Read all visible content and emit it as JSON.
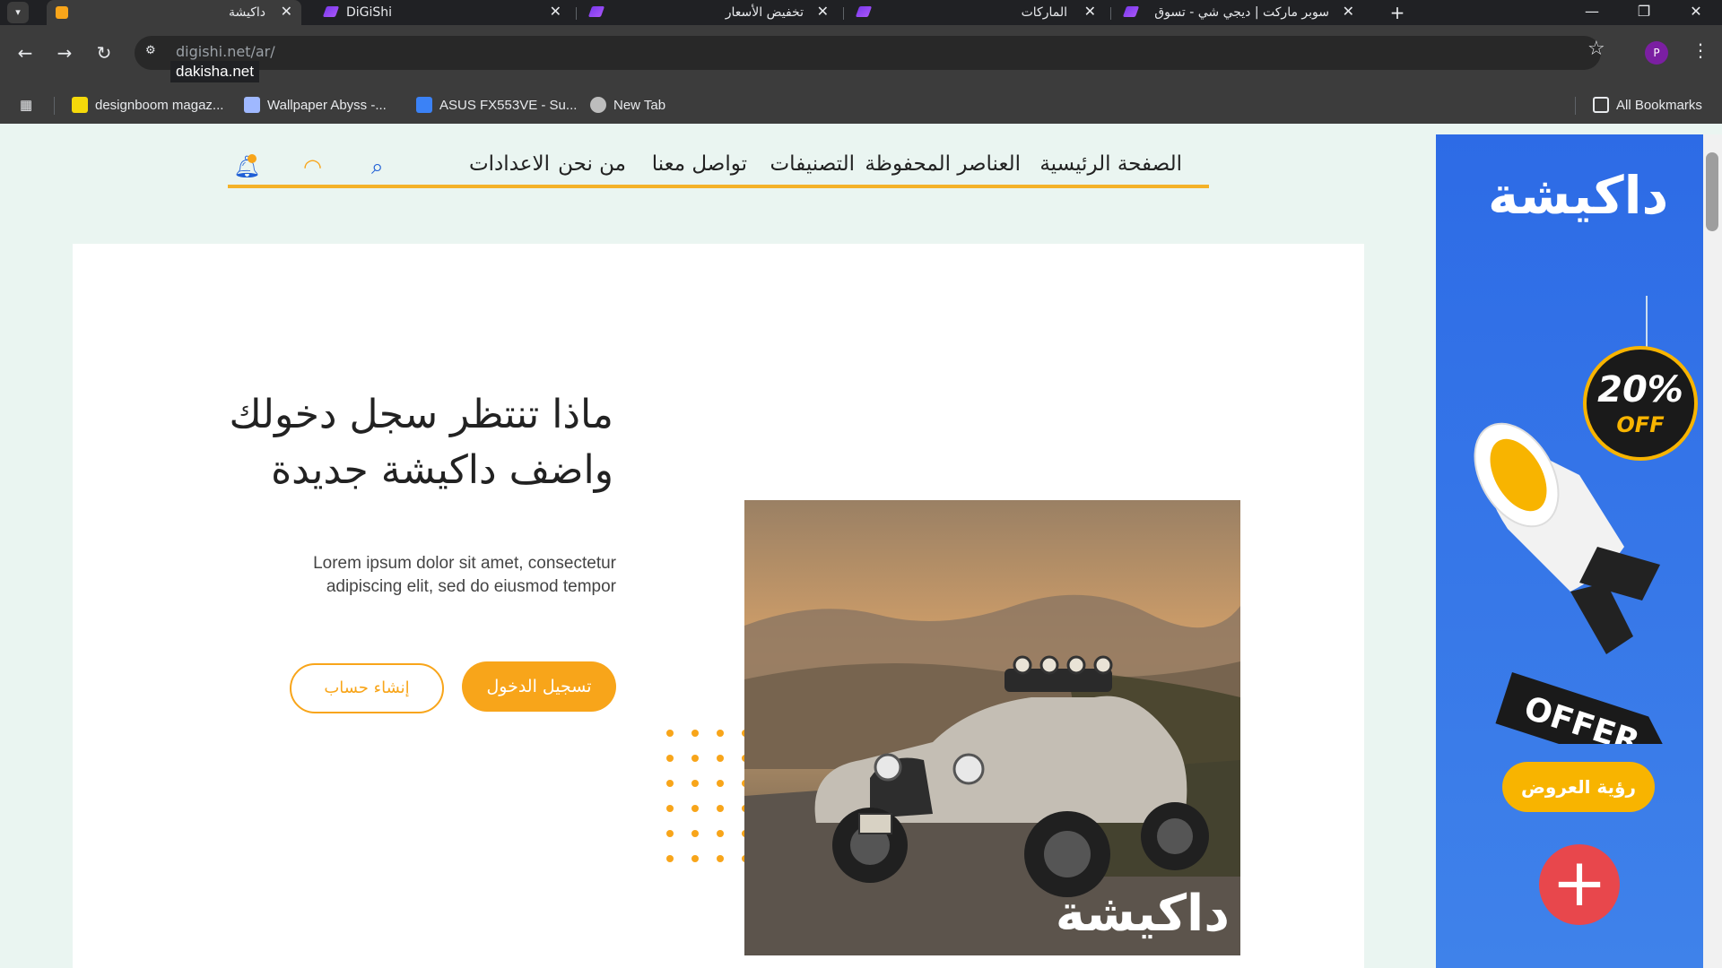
{
  "browser": {
    "tab_menu_icon": "chevron-down-icon",
    "tabs": [
      {
        "title": "داكيشة",
        "close": "✕",
        "active": true
      },
      {
        "title": "DiGiShi",
        "close": "✕",
        "active": false
      },
      {
        "title": "تخفيض الأسعار",
        "close": "✕",
        "active": false
      },
      {
        "title": "الماركات",
        "close": "✕",
        "active": false
      },
      {
        "title": "سوبر ماركت | ديجي شي - تسوق",
        "close": "✕",
        "active": false
      }
    ],
    "new_tab": "+",
    "window_controls": {
      "minimize": "—",
      "restore": "❐",
      "close": "✕"
    },
    "url": "digishi.net/ar/",
    "url_tooltip": "dakisha.net",
    "profile_initial": "P",
    "bookmarks": [
      {
        "label": "designboom magaz...",
        "icon_color": "#f5d90a"
      },
      {
        "label": "Wallpaper Abyss -...",
        "icon_color": "#9fb8ff"
      },
      {
        "label": "ASUS FX553VE - Su...",
        "icon_color": "#3b82f6"
      },
      {
        "label": "New Tab",
        "icon_color": "#bdbdbd"
      }
    ],
    "all_bookmarks": "All Bookmarks"
  },
  "site": {
    "nav": {
      "items": [
        "الصفحة الرئيسية",
        "العناصر المحفوظة",
        "التصنيفات",
        "تواصل معنا",
        "من نحن",
        "الاعدادات"
      ],
      "search_icon": "search-icon",
      "user_icon": "user-icon",
      "bell_icon": "bell-icon"
    },
    "hero": {
      "title_line1": "ماذا تنتظر سجل دخولك",
      "title_line2": "واضف داكيشة جديدة",
      "text_line1": "Lorem ipsum dolor sit amet, consectetur",
      "text_line2": "adipiscing elit, sed do eiusmod tempor",
      "login_label": "تسجيل الدخول",
      "register_label": "إنشاء حساب",
      "watermark": "داكيشة"
    },
    "ad": {
      "logo": "داكيشة",
      "badge_top": "20%",
      "badge_bottom": "OFF",
      "tag": "OFFER",
      "button": "رؤية العروض",
      "plus": "+"
    },
    "colors": {
      "accent": "#f8a51a",
      "ad_blue": "#2d6be6",
      "plus_red": "#e8474c"
    }
  }
}
